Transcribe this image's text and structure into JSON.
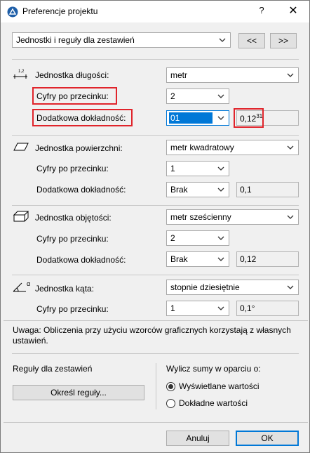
{
  "window": {
    "title": "Preferencje projektu",
    "help_label": "?",
    "close_label": "✕"
  },
  "top": {
    "page_select": "Jednostki i reguły dla zestawień",
    "prev_label": "<<",
    "next_label": ">>"
  },
  "length": {
    "unit_label": "Jednostka długości:",
    "unit_value": "metr",
    "decimals_label": "Cyfry po przecinku:",
    "decimals_value": "2",
    "extra_label": "Dodatkowa dokładność:",
    "extra_value": "01",
    "preview_main": "0,12",
    "preview_sup": "31"
  },
  "area": {
    "unit_label": "Jednostka powierzchni:",
    "unit_value": "metr kwadratowy",
    "decimals_label": "Cyfry po przecinku:",
    "decimals_value": "1",
    "extra_label": "Dodatkowa dokładność:",
    "extra_value": "Brak",
    "preview": "0,1"
  },
  "volume": {
    "unit_label": "Jednostka objętości:",
    "unit_value": "metr sześcienny",
    "decimals_label": "Cyfry po przecinku:",
    "decimals_value": "2",
    "extra_label": "Dodatkowa dokładność:",
    "extra_value": "Brak",
    "preview": "0,12"
  },
  "angle": {
    "unit_label": "Jednostka kąta:",
    "unit_value": "stopnie dziesiętnie",
    "decimals_label": "Cyfry po przecinku:",
    "decimals_value": "1",
    "preview": "0,1°"
  },
  "note": {
    "line1": "Uwaga: Obliczenia przy użyciu wzorców graficznych korzystają z własnych",
    "line2": "ustawień."
  },
  "rules": {
    "heading": "Reguły dla zestawień",
    "button": "Określ reguły..."
  },
  "sums": {
    "heading": "Wylicz sumy w oparciu o:",
    "option1": "Wyświetlane wartości",
    "option2": "Dokładne wartości",
    "selected": "option1"
  },
  "footer": {
    "cancel": "Anuluj",
    "ok": "OK"
  },
  "colors": {
    "highlight": "#e0242b",
    "selection": "#0078d7"
  }
}
